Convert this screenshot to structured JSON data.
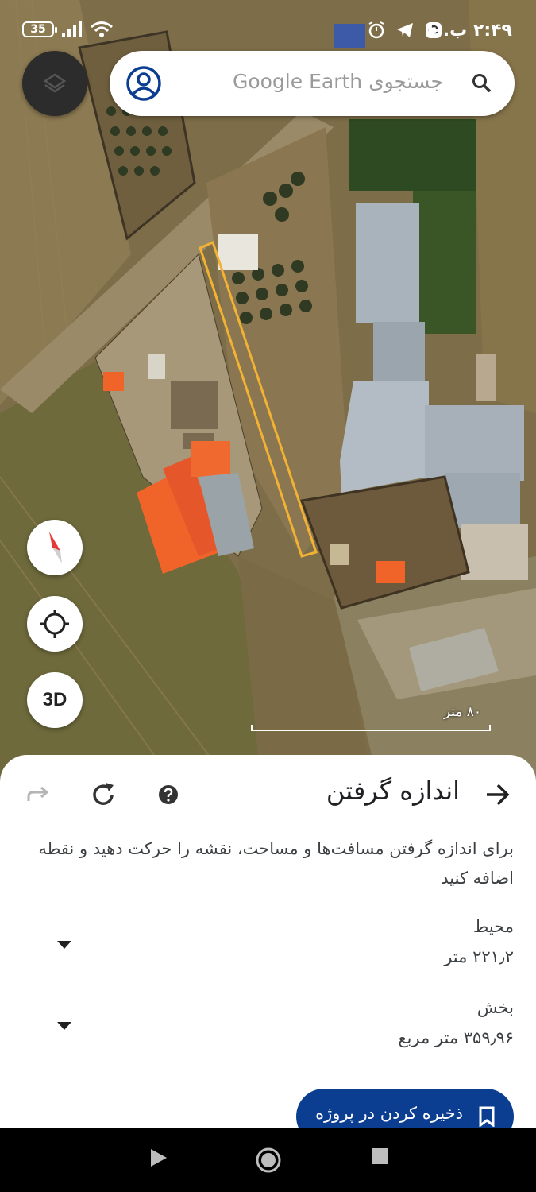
{
  "status_bar": {
    "time": "۲:۴۹ ب.ظ",
    "battery": "35"
  },
  "search": {
    "placeholder": "جستجوی Google Earth"
  },
  "map": {
    "compass_label": "compass",
    "locate_label": "my-location",
    "view_3d_label": "3D",
    "scale_label": "۸۰ متر",
    "measure_line_color": "#f2b233"
  },
  "sheet": {
    "title": "اندازه گرفتن",
    "description": "برای اندازه گرفتن مسافت‌ها و مساحت، نقشه را حرکت دهید و نقطه اضافه کنید",
    "perimeter": {
      "label": "محیط",
      "value": "۲۲۱٫۲ متر"
    },
    "area": {
      "label": "بخش",
      "value": "۳۵۹٫۹۶ متر مربع"
    },
    "save_label": "ذخیره کردن در پروژه"
  },
  "colors": {
    "accent": "#0b3d91",
    "roof_orange": "#f0642a",
    "roof_gray": "#a7b0b8"
  }
}
